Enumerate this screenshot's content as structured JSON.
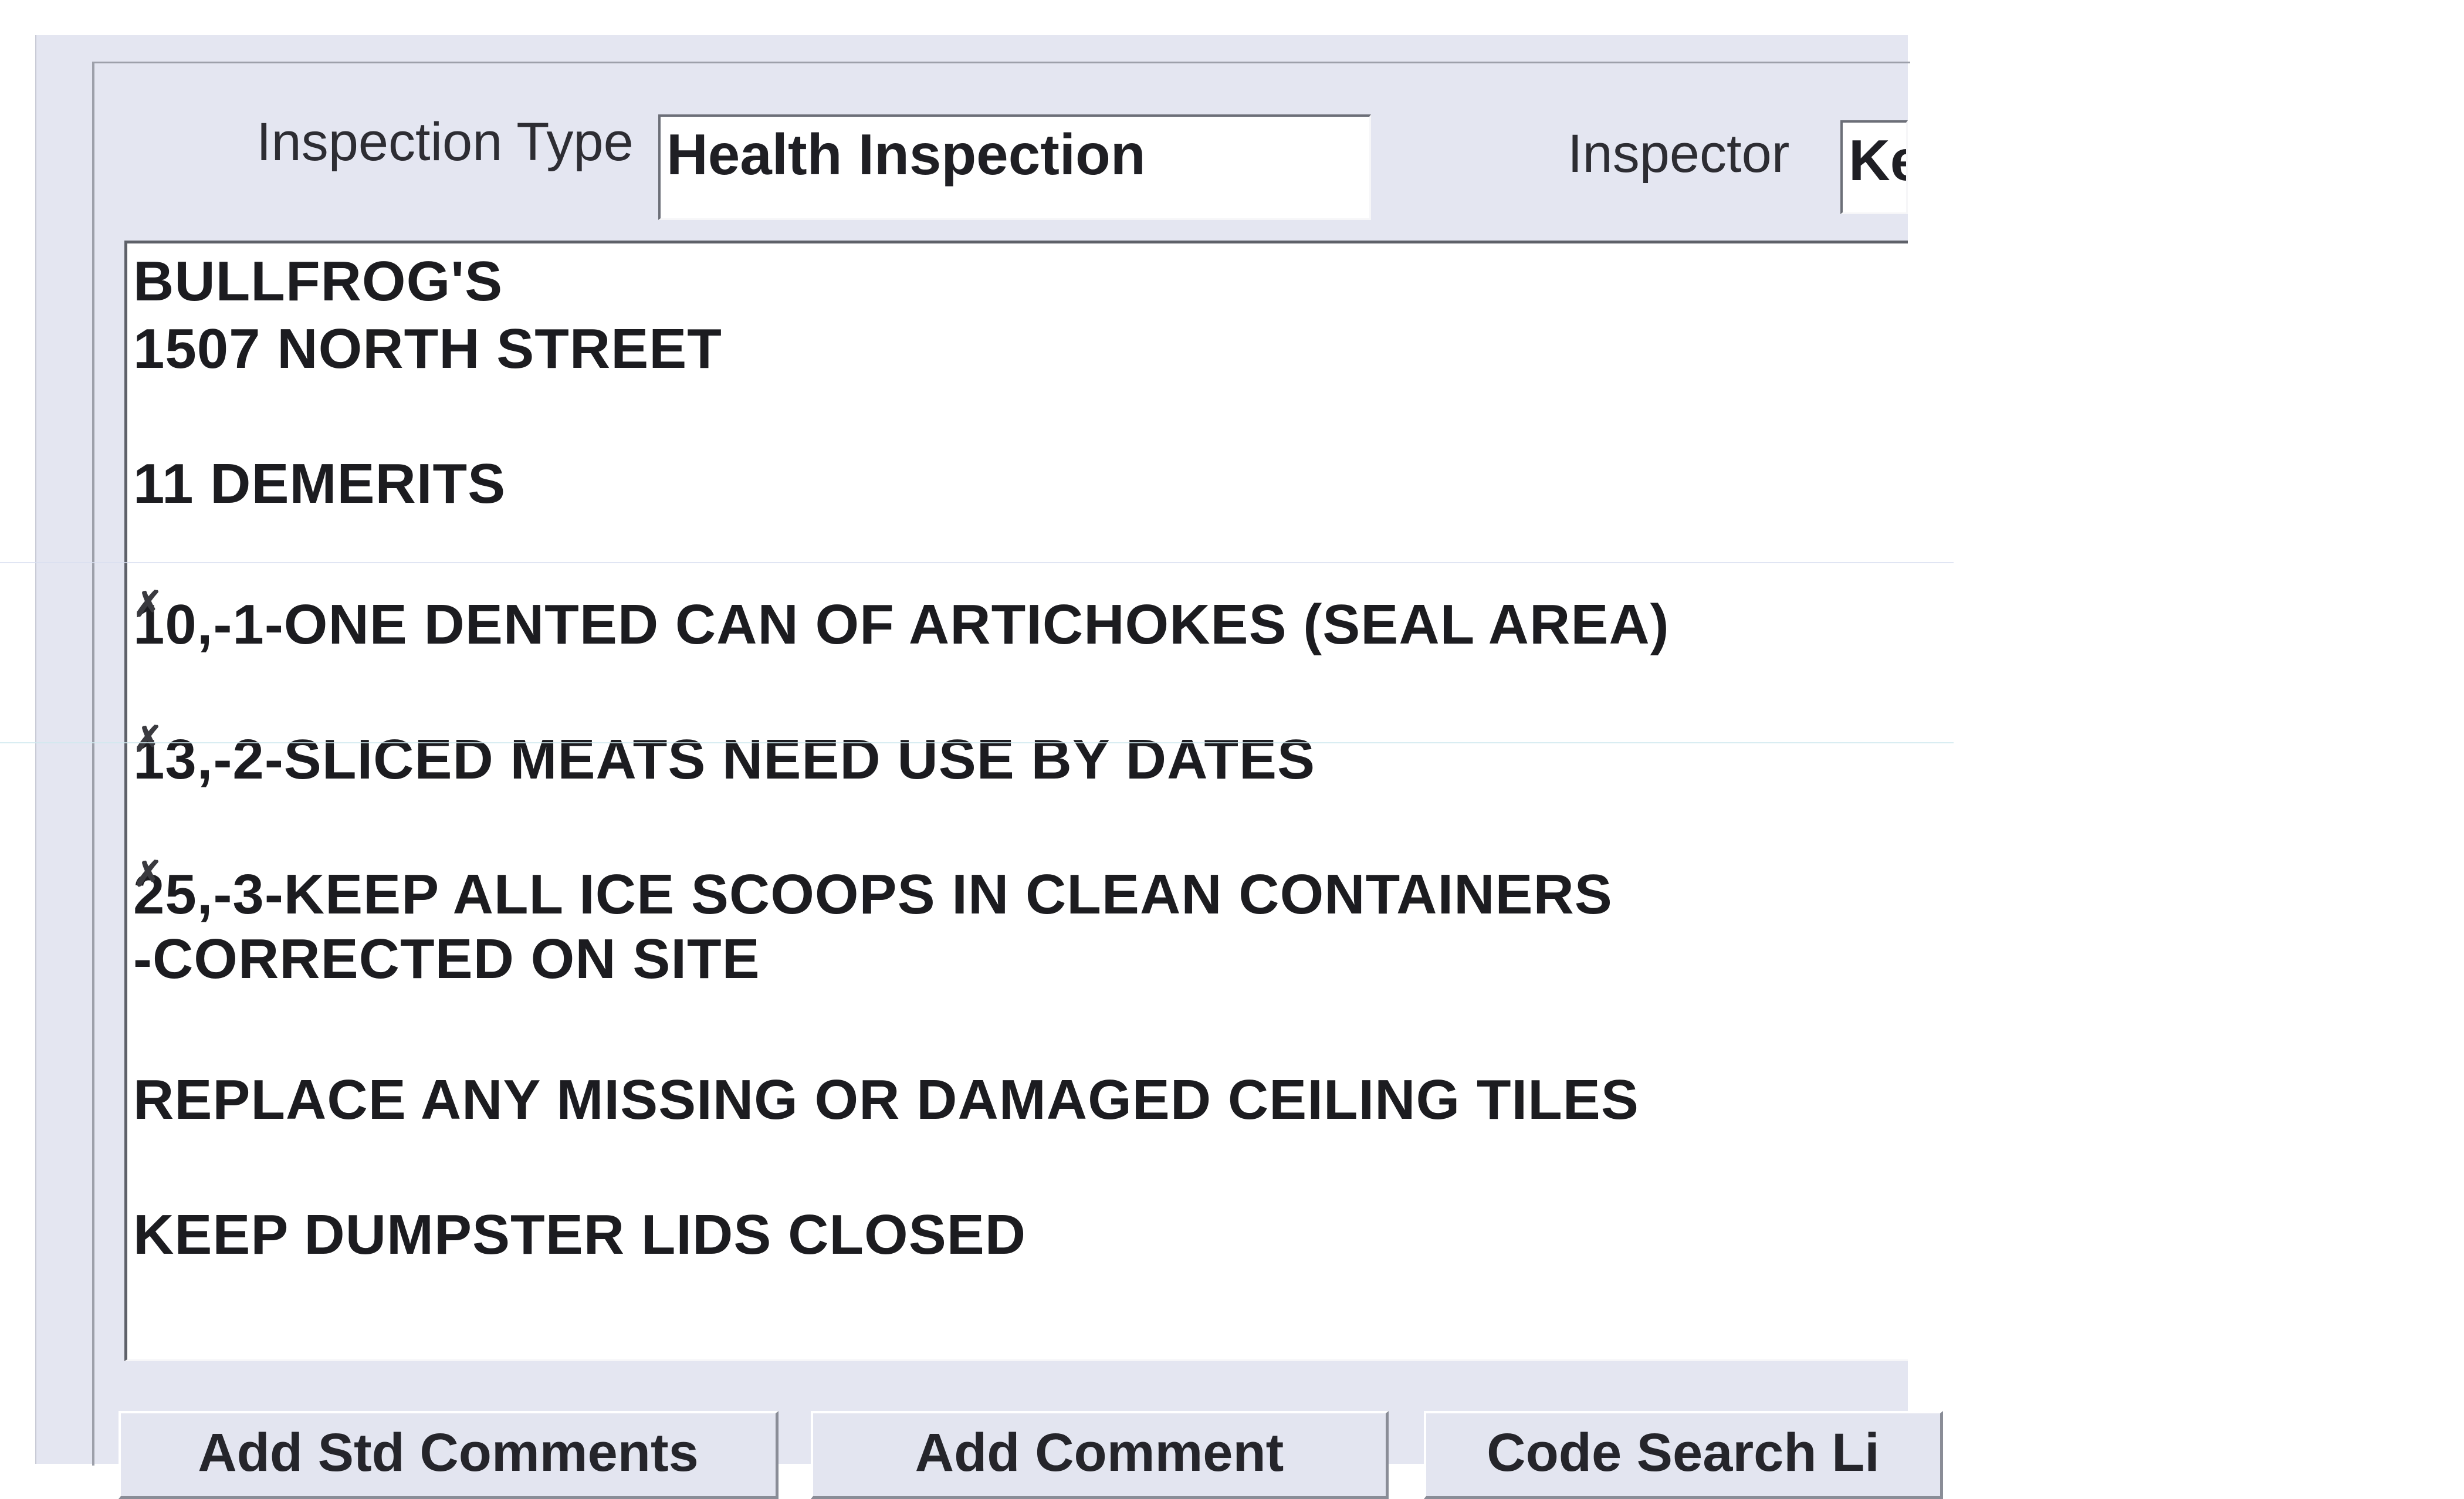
{
  "form": {
    "inspection_type_label": "Inspection Type",
    "inspection_type_value": "Health Inspection",
    "inspector_label": "Inspector",
    "inspector_value": "Ke"
  },
  "comments": {
    "lines": [
      "BULLFROG'S",
      "1507 NORTH STREET",
      "",
      "11 DEMERITS",
      "",
      "10,-1-ONE DENTED CAN OF ARTICHOKES (SEAL AREA)",
      "",
      "13,-2-SLICED MEATS NEED USE BY DATES",
      "",
      "25,-3-KEEP ALL ICE SCOOPS IN CLEAN CONTAINERS",
      "-CORRECTED ON SITE",
      "",
      "REPLACE ANY MISSING OR DAMAGED CEILING TILES",
      "",
      "KEEP DUMPSTER LIDS CLOSED"
    ]
  },
  "buttons": {
    "add_std_comments": "Add Std Comments",
    "add_comment": "Add Comment",
    "code_search": "Code Search Li"
  }
}
